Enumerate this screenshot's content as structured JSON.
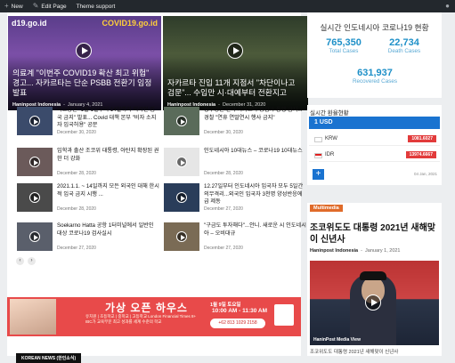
{
  "adminbar": {
    "new_label": "New",
    "edit_label": "Edit Page",
    "theme_label": "Theme support"
  },
  "hero": [
    {
      "tag": "d19.go.id",
      "tag2": "COVID19.go.id",
      "title": "의료계 \"이번주 COVID19 확산 최고 위험\" 경고... 자카르타는 단순 PSBB 전환기 임정 발표",
      "author": "Haninpost Indonesia",
      "date": "January 4, 2021"
    },
    {
      "title": "자카르타 진입 11개 지점서 \"차단이나고 검문\"... 수입만 시·대예부터 전환지고",
      "author": "Haninpost Indonesia",
      "date": "December 31, 2020"
    }
  ],
  "list": [
    {
      "title": "외교장관 \"1월 1일부터 14일까지 외국인 입국 금지\" 발표... Covid 대책 본부 \"비자 소지자 입국허용\" 공문",
      "date": "December 30, 2020"
    },
    {
      "title": "송구영신 전야 자카르타 중심가 통행 금지...경찰 \"연휴 연말연시 행사 금지\"",
      "date": "December 30, 2020"
    },
    {
      "title": "입학과 출산 조코위 대통령, 아탄지 확장된 권한 더 강화",
      "date": "December 28, 2020"
    },
    {
      "title": "인도네시아 10대뉴스 – 코로나19 10대뉴스",
      "date": "December 28, 2020"
    },
    {
      "title": "2021.1.1. ~ 14일까지 모든 외국인 대해 한시적 입국 금지 시행 ...",
      "date": "December 28, 2020"
    },
    {
      "title": "12.27일부터 인도네시아 입국자 모두 5일간 의무격리...외국인 입국자 3천명 양성반응에 급 제동",
      "date": "December 27, 2020"
    },
    {
      "title": "Soekarno Hatta 공항 1터미널에서 일반인 대상 코로나19 검사실시",
      "date": "December 27, 2020"
    },
    {
      "title": "\"구금도 투자해다\"...안니. 새로운 시 인도네시아 – 오비대규",
      "date": "December 27, 2020"
    }
  ],
  "list_thumb_icons": [
    "play-icon"
  ],
  "banner": {
    "big": "가상 오픈 하우스",
    "small": "유치원 | 초등학교 | 중학교 | 고등학교 London Financial Times 8+ IBC가 교육부문 최고 성과를 세계 수준의 학교",
    "date1": "1월 9일 토요일",
    "date2": "10:00 AM - 11:30 AM",
    "call": "+62 813 1029 2158"
  },
  "section_label": "KOREAN NEWS (한인소식)",
  "covid": {
    "title": "실시간 인도네시아 코로나19 현황",
    "total": "765,350",
    "total_label": "Total Cases",
    "death": "22,734",
    "death_label": "Death Cases",
    "recovered": "631,937",
    "recovered_label": "Recovered Cases"
  },
  "fx": {
    "title": "실시간 환율현황",
    "head": "1 USD",
    "rows": [
      {
        "currency": "KRW",
        "value": "1081.6027",
        "flag": "kr"
      },
      {
        "currency": "IDR",
        "value": "13974.6667",
        "flag": "id"
      }
    ],
    "add": "+",
    "date": "04 Jan, 2021"
  },
  "multimedia": {
    "tag": "Multimedia",
    "title": "조코위도도 대통령 2021년 새해맞이 신년사",
    "author": "Haninpost Indonesia",
    "date": "January 1, 2021",
    "caption": "HaninPost Media View",
    "foot": "조코위도도 대통령 2021년 새해맞이 신년사"
  },
  "colors": {
    "accent_blue": "#1a73d0",
    "covid_blue": "#1e90c8",
    "fx_red": "#e23b3b",
    "multimedia_orange": "#e06b2a",
    "banner_red": "#e84a4a"
  }
}
